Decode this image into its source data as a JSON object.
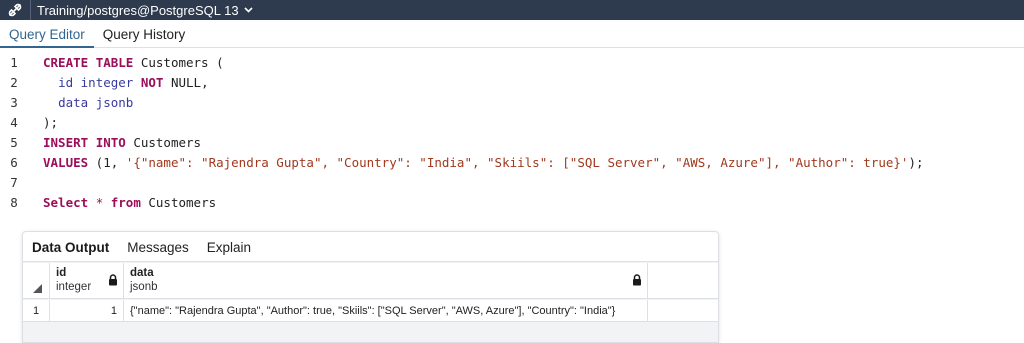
{
  "connection": {
    "label": "Training/postgres@PostgreSQL 13",
    "icon": "connection-plug-icon",
    "caret_icon": "chevron-down-icon"
  },
  "editor_tabs": [
    "Query Editor",
    "Query History"
  ],
  "code_lines": [
    {
      "n": "1",
      "tokens": [
        [
          "kw",
          "CREATE"
        ],
        [
          "t",
          " "
        ],
        [
          "kw",
          "TABLE"
        ],
        [
          "t",
          " Customers ("
        ]
      ]
    },
    {
      "n": "2",
      "tokens": [
        [
          "t",
          "  "
        ],
        [
          "ty",
          "id"
        ],
        [
          "t",
          " "
        ],
        [
          "ty",
          "integer"
        ],
        [
          "t",
          " "
        ],
        [
          "kw",
          "NOT"
        ],
        [
          "t",
          " NULL,"
        ]
      ]
    },
    {
      "n": "3",
      "tokens": [
        [
          "t",
          "  "
        ],
        [
          "ty",
          "data"
        ],
        [
          "t",
          " "
        ],
        [
          "ty",
          "jsonb"
        ]
      ]
    },
    {
      "n": "4",
      "tokens": [
        [
          "t",
          ");"
        ]
      ]
    },
    {
      "n": "5",
      "tokens": [
        [
          "kw",
          "INSERT"
        ],
        [
          "t",
          " "
        ],
        [
          "kw",
          "INTO"
        ],
        [
          "t",
          " Customers"
        ]
      ]
    },
    {
      "n": "6",
      "tokens": [
        [
          "kw",
          "VALUES"
        ],
        [
          "t",
          " (1, "
        ],
        [
          "str",
          "'{\"name\": \"Rajendra Gupta\", \"Country\": \"India\", \"Skiils\": [\"SQL Server\", \"AWS, Azure\"], \"Author\": true}'"
        ],
        [
          "t",
          ");"
        ]
      ]
    },
    {
      "n": "7",
      "tokens": []
    },
    {
      "n": "8",
      "tokens": [
        [
          "kw",
          "Select"
        ],
        [
          "t",
          " "
        ],
        [
          "op",
          "*"
        ],
        [
          "t",
          " "
        ],
        [
          "kw",
          "from"
        ],
        [
          "t",
          " Customers"
        ]
      ]
    }
  ],
  "output": {
    "tabs": [
      "Data Output",
      "Messages",
      "Explain"
    ],
    "columns": [
      {
        "name": "id",
        "type": "integer"
      },
      {
        "name": "data",
        "type": "jsonb"
      }
    ],
    "rows": [
      {
        "row_num": "1",
        "id": "1",
        "data": "{\"name\": \"Rajendra Gupta\", \"Author\": true, \"Skiils\": [\"SQL Server\", \"AWS, Azure\"], \"Country\": \"India\"}"
      }
    ]
  },
  "colors": {
    "topbar": "#2e3b4e",
    "keyword": "#9a0e5a",
    "type": "#3a3a9e",
    "string": "#a1391d",
    "active_tab": "#326690"
  }
}
